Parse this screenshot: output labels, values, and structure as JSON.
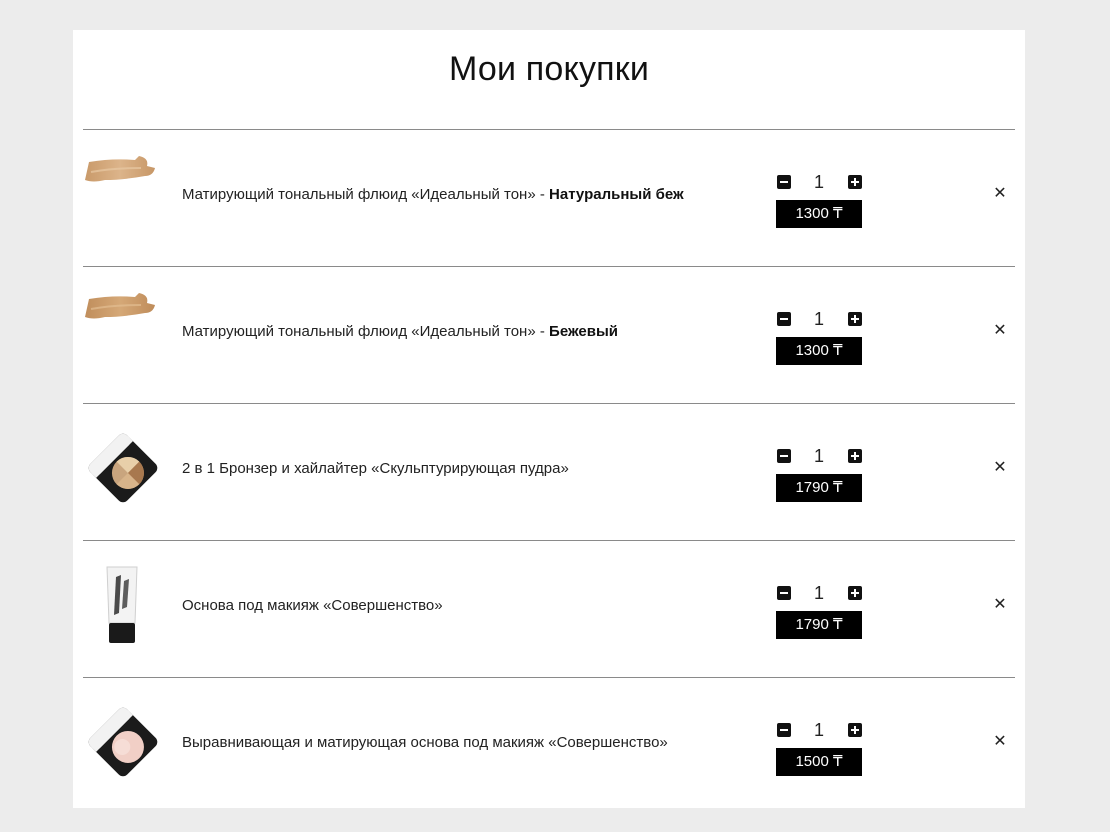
{
  "page": {
    "title": "Мои покупки"
  },
  "cart": {
    "items": [
      {
        "image": "foundation-swatch",
        "name": "Матирующий тональный флюид «Идеальный тон»",
        "separator": " - ",
        "variant": "Натуральный беж",
        "quantity": "1",
        "price": "1300 ₸",
        "minus_icon": "minus-icon",
        "plus_icon": "plus-icon",
        "remove_icon": "close-icon"
      },
      {
        "image": "foundation-swatch",
        "name": "Матирующий тональный флюид «Идеальный тон»",
        "separator": " - ",
        "variant": "Бежевый",
        "quantity": "1",
        "price": "1300 ₸",
        "minus_icon": "minus-icon",
        "plus_icon": "plus-icon",
        "remove_icon": "close-icon"
      },
      {
        "image": "bronzer-compact",
        "name": "2 в 1 Бронзер и хайлайтер «Скульптурирующая пудра»",
        "separator": "",
        "variant": "",
        "quantity": "1",
        "price": "1790 ₸",
        "minus_icon": "minus-icon",
        "plus_icon": "plus-icon",
        "remove_icon": "close-icon"
      },
      {
        "image": "primer-tube",
        "name": "Основа под макияж «Совершенство»",
        "separator": "",
        "variant": "",
        "quantity": "1",
        "price": "1790 ₸",
        "minus_icon": "minus-icon",
        "plus_icon": "plus-icon",
        "remove_icon": "close-icon"
      },
      {
        "image": "powder-compact",
        "name": "Выравнивающая и матирующая основа под макияж «Совершенство»",
        "separator": "",
        "variant": "",
        "quantity": "1",
        "price": "1500 ₸",
        "minus_icon": "minus-icon",
        "plus_icon": "plus-icon",
        "remove_icon": "close-icon"
      }
    ]
  },
  "colors": {
    "background": "#ececec",
    "panel": "#ffffff",
    "price_badge": "#000000",
    "divider": "#8a8a8a"
  }
}
